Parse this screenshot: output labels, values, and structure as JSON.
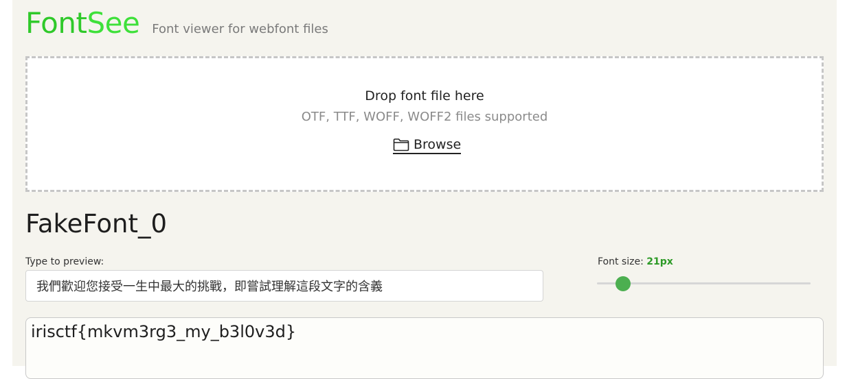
{
  "app": {
    "logo_part1": "Font",
    "logo_part2": "See",
    "tagline": "Font viewer for webfont files"
  },
  "dropzone": {
    "title": "Drop font file here",
    "subtitle": "OTF, TTF, WOFF, WOFF2 files supported",
    "browse_label": "Browse",
    "browse_icon": "folder-icon"
  },
  "font": {
    "name": "FakeFont_0"
  },
  "preview": {
    "label": "Type to preview:",
    "value": "我們歡迎您接受一生中最大的挑戰，即嘗試理解這段文字的含義"
  },
  "font_size": {
    "label": "Font size:",
    "value_text": "21px",
    "value": 21
  },
  "output": {
    "text": "irisctf{mkvm3rg3_my_b3l0v3d}"
  },
  "colors": {
    "brand_green": "#2fc92a",
    "accent_green": "#4caf50",
    "background": "#f5f4ee"
  }
}
